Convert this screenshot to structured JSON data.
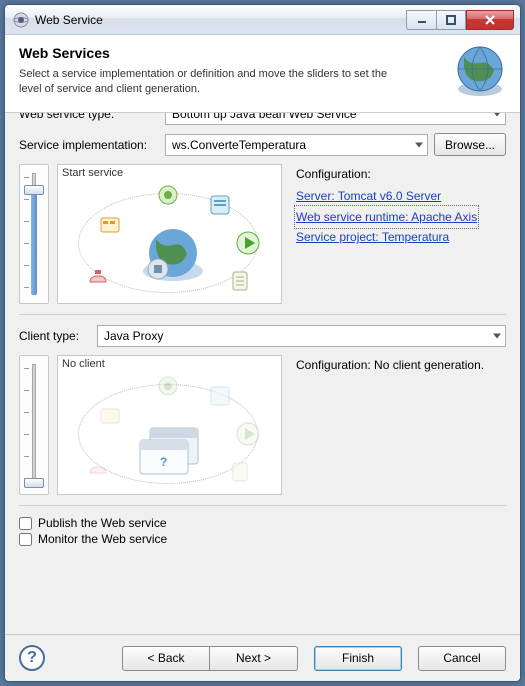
{
  "window": {
    "title": "Web Service"
  },
  "header": {
    "title": "Web Services",
    "subtitle": "Select a service implementation or definition and move the sliders to set the level of service and client generation."
  },
  "form": {
    "ws_type_label": "Web service type:",
    "ws_type_value": "Bottom up Java bean Web Service",
    "impl_label": "Service implementation:",
    "impl_value": "ws.ConverteTemperatura",
    "browse_label": "Browse...",
    "client_type_label": "Client type:",
    "client_type_value": "Java Proxy"
  },
  "service_section": {
    "preview_caption": "Start service",
    "config_header": "Configuration:",
    "links": {
      "server": "Server: Tomcat v6.0 Server",
      "runtime": "Web service runtime: Apache Axis",
      "project": "Service project: Temperatura"
    }
  },
  "client_section": {
    "preview_caption": "No client",
    "config_text": "Configuration: No client generation."
  },
  "checks": {
    "publish": "Publish the Web service",
    "monitor": "Monitor the Web service"
  },
  "footer": {
    "back": "< Back",
    "next": "Next >",
    "finish": "Finish",
    "cancel": "Cancel"
  }
}
